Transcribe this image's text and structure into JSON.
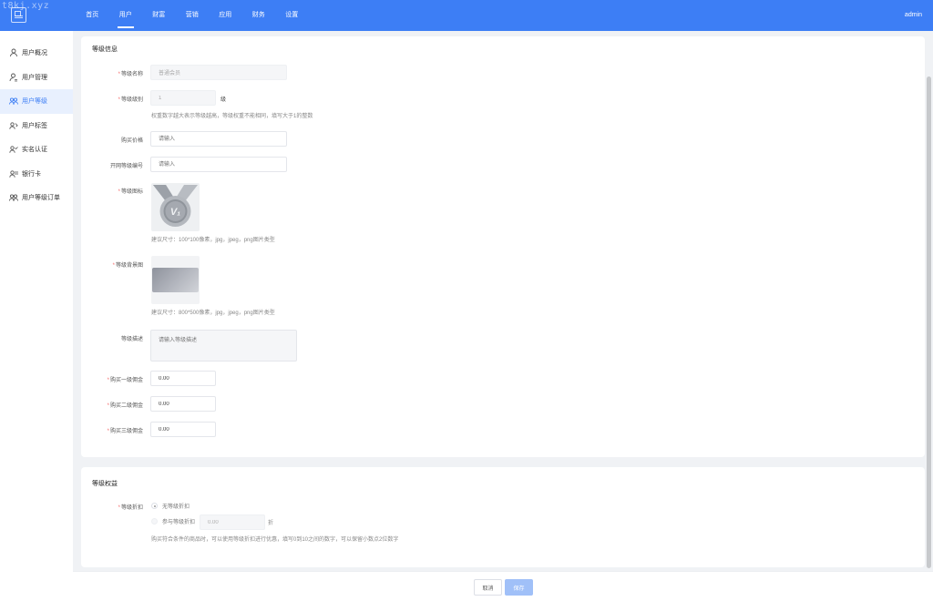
{
  "watermark": "t8kj.xyz",
  "nav": [
    "首页",
    "用户",
    "财富",
    "营销",
    "应用",
    "财务",
    "设置"
  ],
  "user": "admin",
  "sidebar": [
    {
      "label": "用户概况",
      "icon": "user-icon"
    },
    {
      "label": "用户管理",
      "icon": "user-manage-icon"
    },
    {
      "label": "用户等级",
      "icon": "users-icon"
    },
    {
      "label": "用户标签",
      "icon": "user-tag-icon"
    },
    {
      "label": "实名认证",
      "icon": "user-verify-icon"
    },
    {
      "label": "银行卡",
      "icon": "bank-card-icon"
    },
    {
      "label": "用户等级订单",
      "icon": "users-order-icon"
    }
  ],
  "level_info": {
    "title": "等级信息",
    "name_label": "等级名称",
    "name_value": "普通会员",
    "grade_label": "等级级别",
    "grade_value": "1",
    "grade_unit": "级",
    "grade_hint": "权重数字越大表示等级越高，等级权重不能相同，填写大于1的整数",
    "price_label": "购买价格",
    "price_placeholder": "请输入",
    "network_label": "开网等级编号",
    "network_placeholder": "请输入",
    "icon_label": "等级图标",
    "icon_hint": "建议尺寸：100*100像素，jpg，jpeg，png图片类型",
    "bg_label": "等级背景图",
    "bg_hint": "建议尺寸：800*500像素，jpg，jpeg，png图片类型",
    "desc_label": "等级描述",
    "desc_placeholder": "请输入等级描述",
    "commission1_label": "购买一级佣金",
    "commission1_value": "0.00",
    "commission2_label": "购买二级佣金",
    "commission2_value": "0.00",
    "commission3_label": "购买三级佣金",
    "commission3_value": "0.00"
  },
  "level_rights": {
    "title": "等级权益",
    "discount_label": "等级折扣",
    "option_none": "无等级折扣",
    "option_join": "参与等级折扣",
    "discount_value": "0.00",
    "discount_unit": "折",
    "discount_hint": "购买符合条件的商品时，可以使用等级折扣进行优惠，填写0到10之间的数字，可以保留小数点2位数字"
  },
  "footer": {
    "cancel": "取消",
    "save": "保存"
  },
  "colors": {
    "primary": "#3d7ef5",
    "required": "#f56c6c"
  }
}
